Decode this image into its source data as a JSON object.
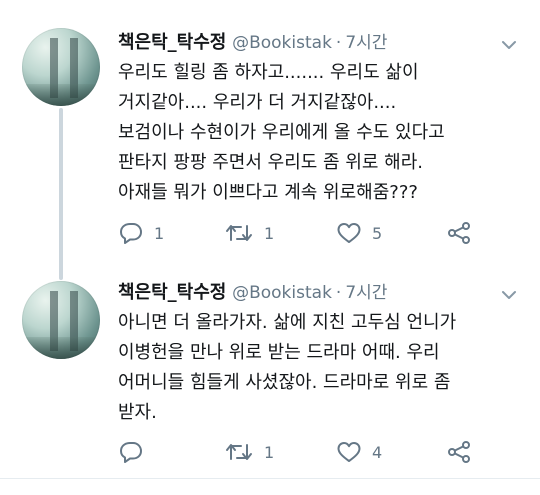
{
  "colors": {
    "text": "#14171a",
    "secondary": "#657786",
    "thread_line": "#ccd6dd",
    "divider": "#e6ecf0"
  },
  "tweets": [
    {
      "display_name": "책은탁_탁수정",
      "handle": "@Bookistak",
      "separator": "·",
      "time": "7시간",
      "avatar": "avatar-photo",
      "lines": [
        "우리도 힐링 좀 하자고....... 우리도 삶이",
        "거지같아.... 우리가 더 거지같잖아....",
        "보검이나 수현이가 우리에게 올 수도 있다고",
        "판타지 팡팡 주면서 우리도 좀 위로 해라.",
        "아재들 뭐가 이쁘다고 계속 위로해줌???"
      ],
      "reply_count": "1",
      "retweet_count": "1",
      "like_count": "5",
      "icons": [
        "reply-icon",
        "retweet-icon",
        "heart-icon",
        "share-icon",
        "chevron-down-icon"
      ]
    },
    {
      "display_name": "책은탁_탁수정",
      "handle": "@Bookistak",
      "separator": "·",
      "time": "7시간",
      "avatar": "avatar-photo",
      "lines": [
        "아니면 더 올라가자. 삶에 지친 고두심 언니가",
        "이병헌을 만나 위로 받는 드라마 어때. 우리",
        "어머니들 힘들게 사셨잖아. 드라마로 위로 좀",
        "받자."
      ],
      "reply_count": "",
      "retweet_count": "1",
      "like_count": "4",
      "icons": [
        "reply-icon",
        "retweet-icon",
        "heart-icon",
        "share-icon",
        "chevron-down-icon"
      ]
    }
  ]
}
